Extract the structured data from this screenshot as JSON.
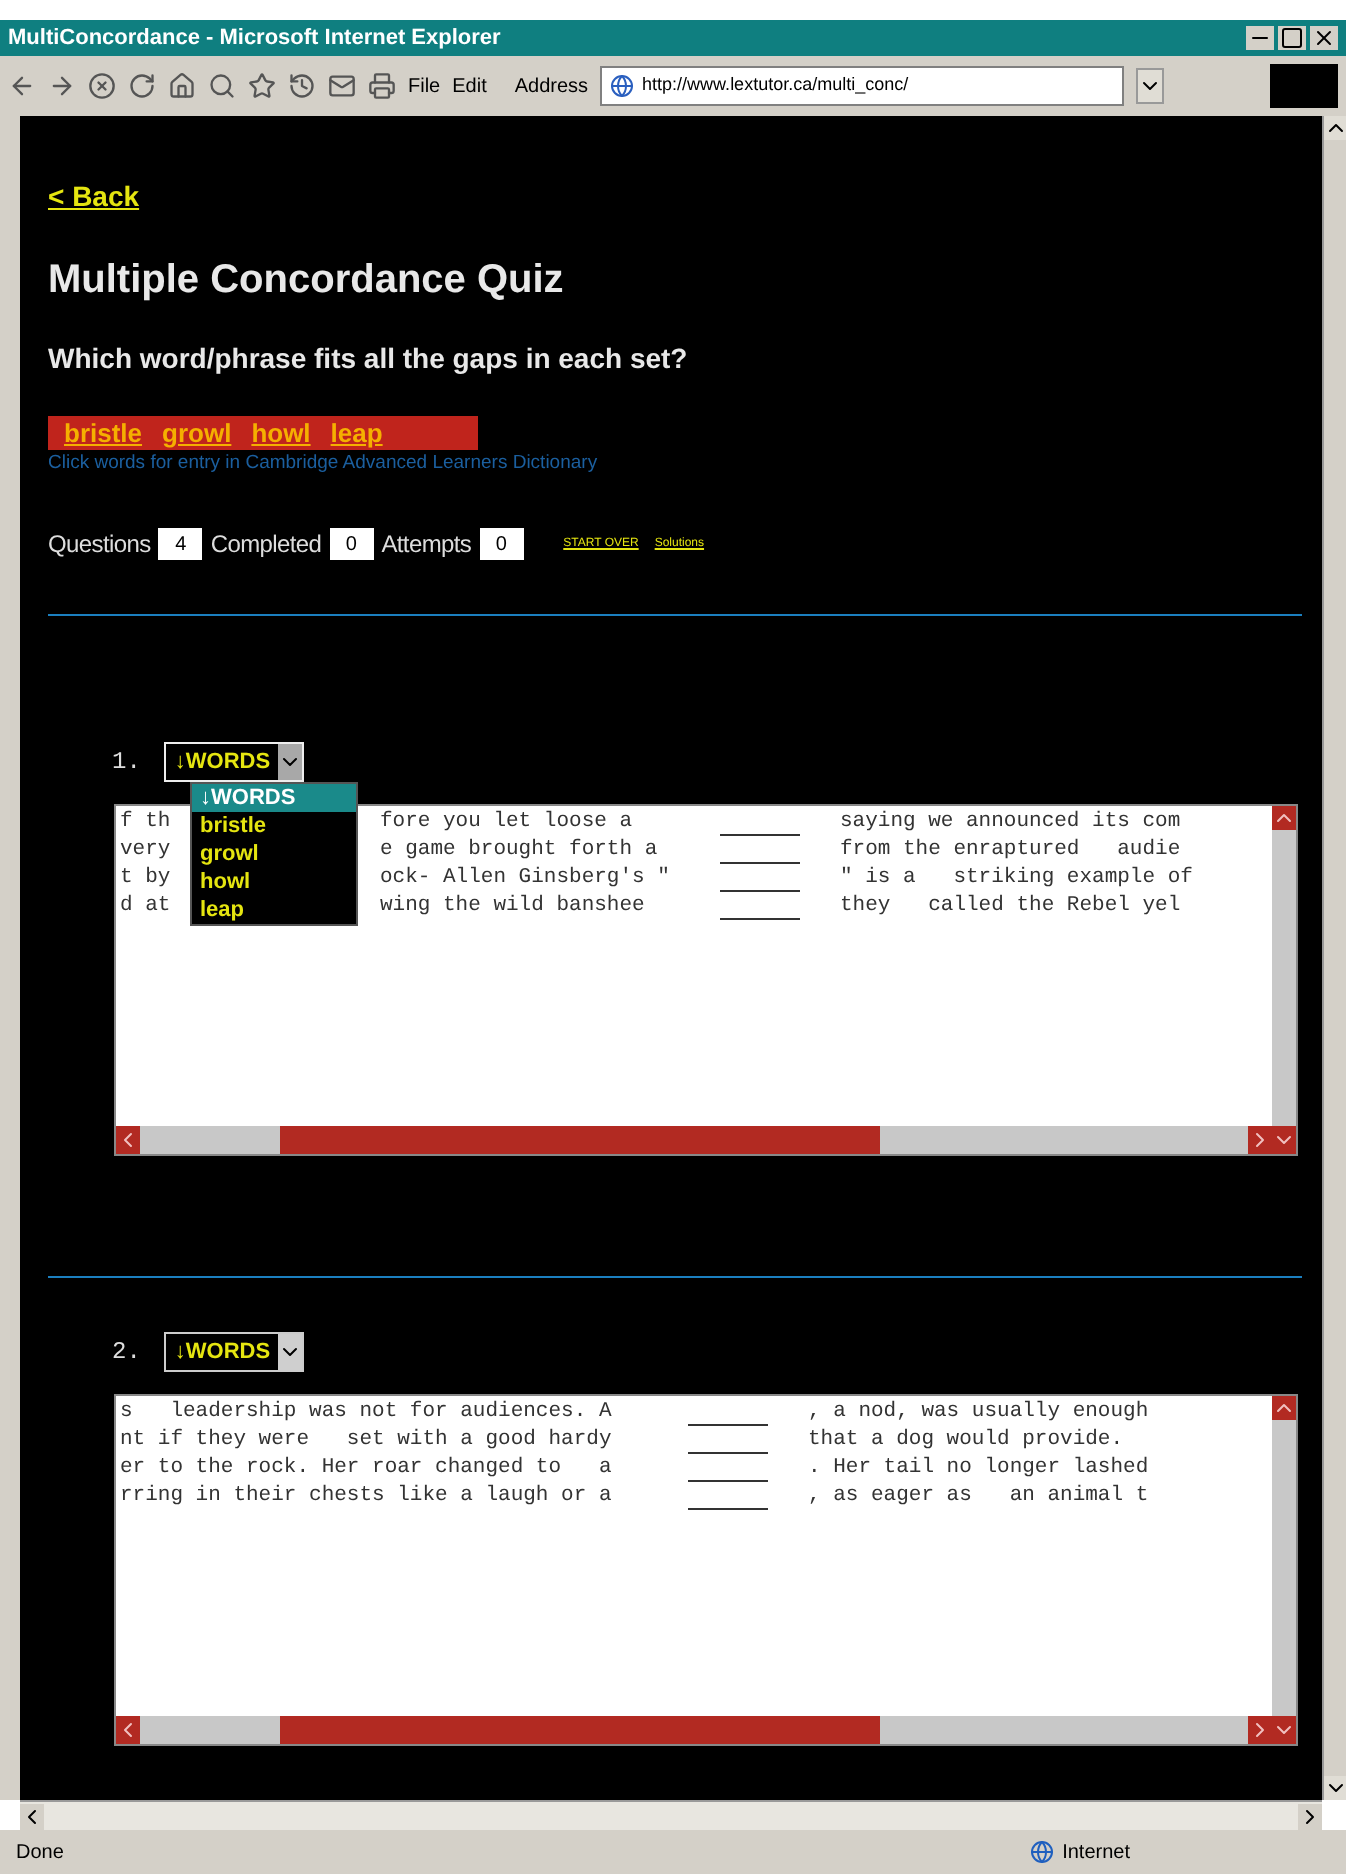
{
  "browser": {
    "title": "MultiConcordance - Microsoft Internet Explorer",
    "menu": [
      "File",
      "Edit"
    ],
    "address_label": "Address",
    "url": "http://www.lextutor.ca/multi_conc/"
  },
  "page": {
    "back_link": "< Back",
    "title": "Multiple Concordance Quiz",
    "question": "Which word/phrase fits all the gaps in each set?",
    "words": [
      "bristle",
      "growl",
      "howl",
      "leap"
    ],
    "hint": "Click words for entry in Cambridge Advanced Learners Dictionary",
    "stats": [
      {
        "label": "Questions",
        "value": "4"
      },
      {
        "label": "Completed",
        "value": "0"
      },
      {
        "label": "Attempts",
        "value": "0"
      }
    ],
    "links": [
      "START OVER",
      "Solutions"
    ],
    "questions": [
      {
        "number": "1.",
        "select": {
          "value": "↓WORDS",
          "expanded": true,
          "options": [
            {
              "label": "↓WORDS",
              "selected": true
            },
            {
              "label": "bristle",
              "selected": false
            },
            {
              "label": "growl",
              "selected": false
            },
            {
              "label": "howl",
              "selected": false
            },
            {
              "label": "leap",
              "selected": false
            }
          ]
        },
        "lines": [
          {
            "start": "f th",
            "before": "fore you let loose a",
            "after": "saying we announced its com"
          },
          {
            "start": "very",
            "before": "e game brought forth a",
            "after": "from the enraptured   audie"
          },
          {
            "start": "t by",
            "before": "ock- Allen Ginsberg's \"",
            "after": "\" is a   striking example of"
          },
          {
            "start": "d at",
            "before": "wing the wild banshee",
            "after": "they   called the Rebel yel"
          }
        ]
      },
      {
        "number": "2.",
        "select": {
          "value": "↓WORDS",
          "expanded": false
        },
        "lines": [
          {
            "before": "s   leadership was not for audiences. A",
            "after": ", a nod, was usually enough"
          },
          {
            "before": "nt if they were   set with a good hardy",
            "after": "that a dog would provide."
          },
          {
            "before": "er to the rock. Her roar changed to   a",
            "after": ". Her tail no longer lashed"
          },
          {
            "before": "rring in their chests like a laugh or a",
            "after": ", as eager as   an animal t"
          }
        ]
      }
    ]
  },
  "status_bar": {
    "text": "Done",
    "zone": "Internet"
  }
}
